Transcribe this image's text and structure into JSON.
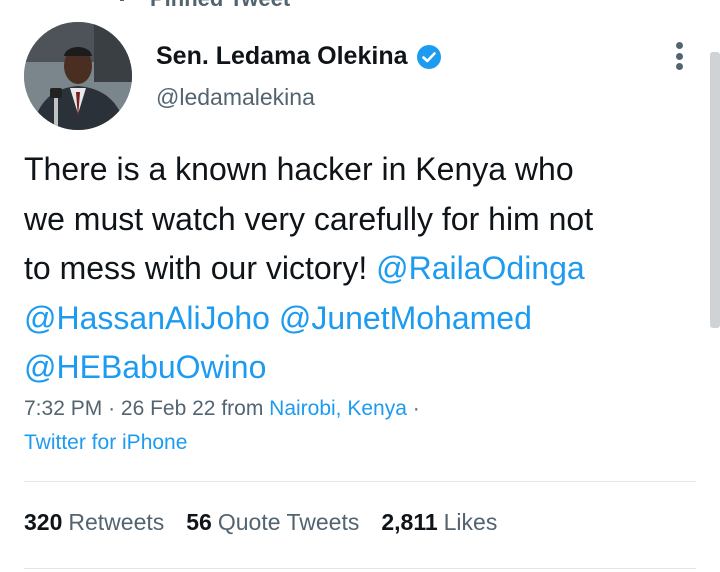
{
  "pinned_label": "Pinned Tweet",
  "author": {
    "name": "Sen. Ledama Olekina",
    "handle": "@ledamalekina",
    "verified_color": "#1d9bf0"
  },
  "tweet": {
    "text_line1": "There is a known hacker in Kenya who",
    "text_line2": "we must watch very carefully for him not",
    "text_line3_prefix": "to mess with our victory!",
    "mentions": [
      "@RailaOdinga",
      "@HassanAliJoho",
      "@JunetMohamed",
      "@HEBabuOwino"
    ]
  },
  "meta": {
    "time": "7:32 PM",
    "date": "26 Feb 22",
    "from_label": "from",
    "location": "Nairobi, Kenya",
    "source": "Twitter for iPhone"
  },
  "stats": {
    "retweets_count": "320",
    "retweets_label": "Retweets",
    "quotes_count": "56",
    "quotes_label": "Quote Tweets",
    "likes_count": "2,811",
    "likes_label": "Likes"
  },
  "colors": {
    "link": "#1d9bf0",
    "text": "#0f1419",
    "secondary": "#536471"
  }
}
